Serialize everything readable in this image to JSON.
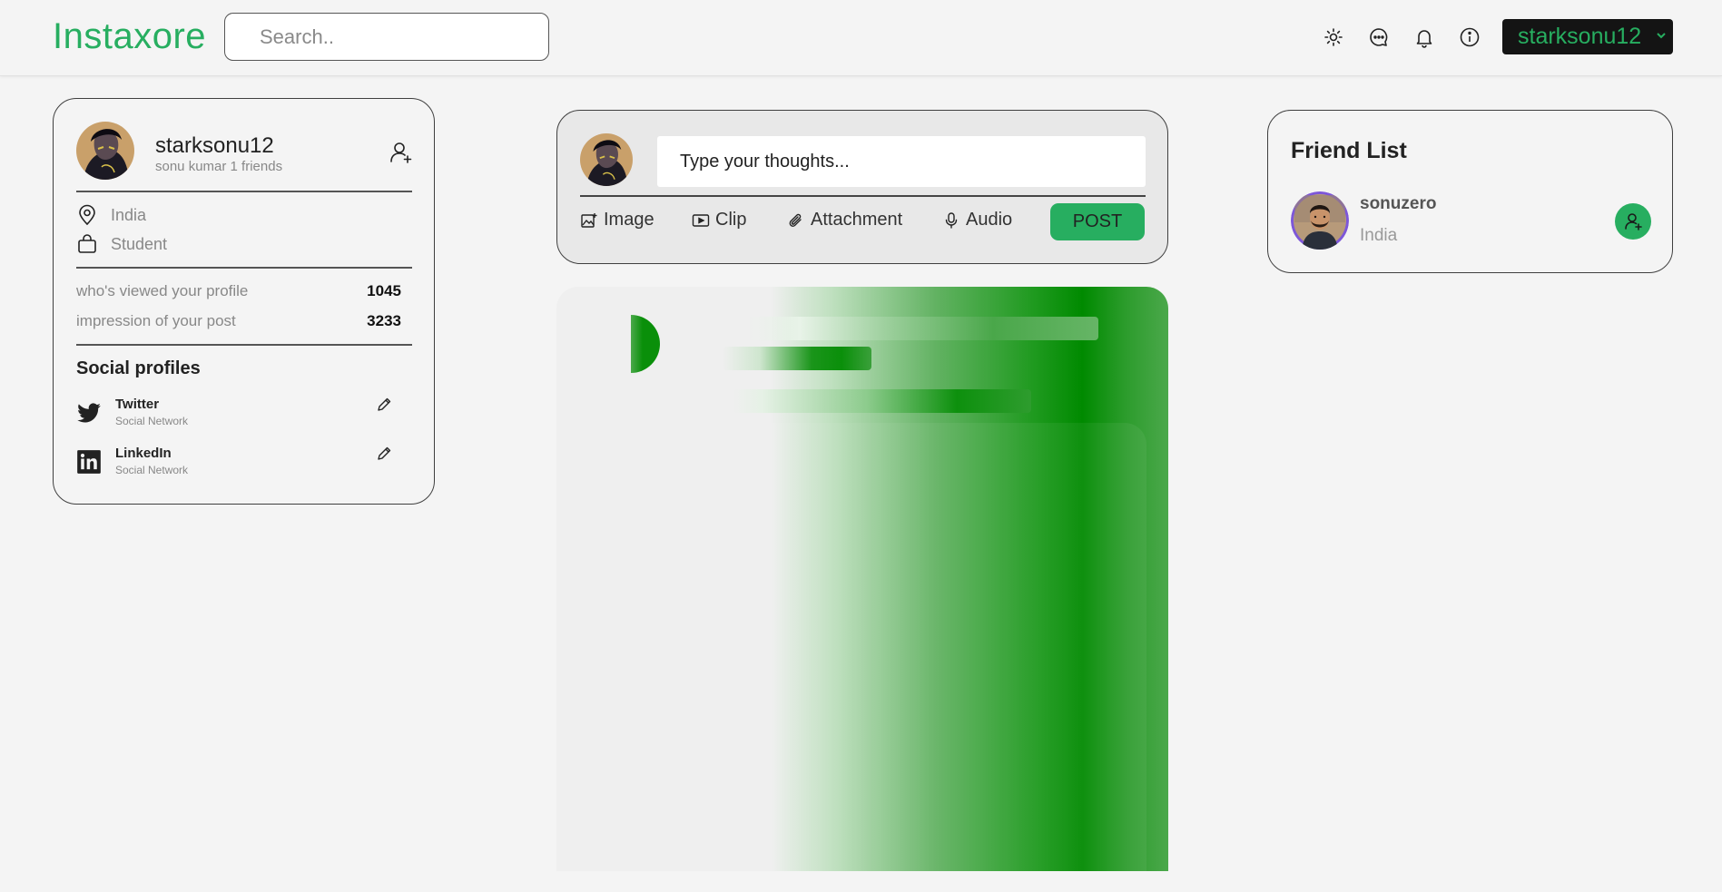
{
  "header": {
    "logo": "Instaxore",
    "search_placeholder": "Search..",
    "icons": [
      "sun-icon",
      "chat-icon",
      "bell-icon",
      "info-icon"
    ],
    "user_menu_label": "starksonu12"
  },
  "profile": {
    "username": "starksonu12",
    "subtitle": "sonu kumar 1 friends",
    "location": "India",
    "occupation": "Student",
    "stats": [
      {
        "label": "who's viewed your profile",
        "value": "1045"
      },
      {
        "label": "impression of your post",
        "value": "3233"
      }
    ],
    "social_title": "Social profiles",
    "socials": [
      {
        "name": "Twitter",
        "type": "Social Network",
        "icon": "twitter-icon"
      },
      {
        "name": "LinkedIn",
        "type": "Social Network",
        "icon": "linkedin-icon"
      }
    ]
  },
  "composer": {
    "placeholder": "Type your thoughts...",
    "tools": [
      {
        "label": "Image",
        "icon": "image-icon"
      },
      {
        "label": "Clip",
        "icon": "clip-icon"
      },
      {
        "label": "Attachment",
        "icon": "paperclip-icon"
      },
      {
        "label": "Audio",
        "icon": "microphone-icon"
      }
    ],
    "post_label": "POST"
  },
  "friends": {
    "title": "Friend List",
    "items": [
      {
        "name": "sonuzero",
        "location": "India"
      }
    ]
  },
  "colors": {
    "accent": "#27ae60",
    "user_menu_bg": "#141414",
    "skeleton_green": "#008a00"
  }
}
